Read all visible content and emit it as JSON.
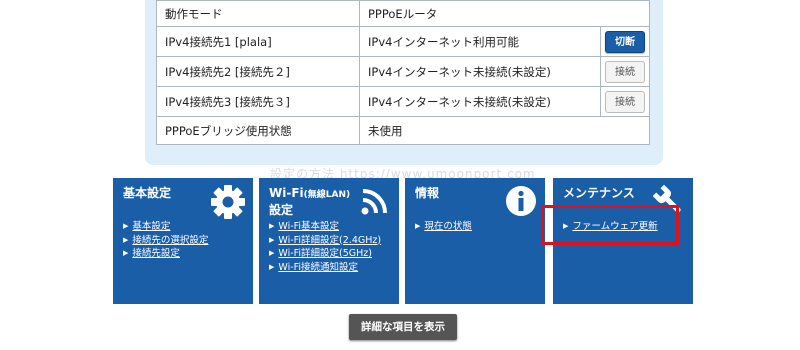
{
  "status_table": {
    "rows": [
      {
        "label": "動作モード",
        "value": "PPPoEルータ"
      },
      {
        "label": "IPv4接続先1 [plala]",
        "value": "IPv4インターネット利用可能",
        "button": "切断"
      },
      {
        "label": "IPv4接続先2 [接続先２]",
        "value": "IPv4インターネット未接続(未設定)",
        "button": "接続"
      },
      {
        "label": "IPv4接続先3 [接続先３]",
        "value": "IPv4インターネット未接続(未設定)",
        "button": "接続"
      },
      {
        "label": "PPPoEブリッジ使用状態",
        "value": "未使用"
      }
    ]
  },
  "tiles": {
    "basic": {
      "title": "基本設定",
      "icon": "gear-icon",
      "links": [
        "基本設定",
        "接続先の選択設定",
        "接続先設定"
      ]
    },
    "wifi": {
      "title_main": "Wi-Fi",
      "title_small": "(無線LAN)",
      "title_line2": "設定",
      "icon": "wifi-icon",
      "links": [
        "Wi-Fi基本設定",
        "Wi-Fi詳細設定(2.4GHz)",
        "Wi-Fi詳細設定(5GHz)",
        "Wi-Fi接続通知設定"
      ]
    },
    "info": {
      "title": "情報",
      "icon": "info-icon",
      "links": [
        "現在の状態"
      ]
    },
    "maintenance": {
      "title": "メンテナンス",
      "icon": "wrench-icon",
      "links": [
        "ファームウェア更新"
      ]
    }
  },
  "detail_button": "詳細な項目を表示",
  "watermark": "設定の方法  https://www.umoonport.com",
  "colors": {
    "tile_blue": "#1a5ea8",
    "highlight_red": "#e3101c",
    "panel_bg": "#deeefa"
  }
}
